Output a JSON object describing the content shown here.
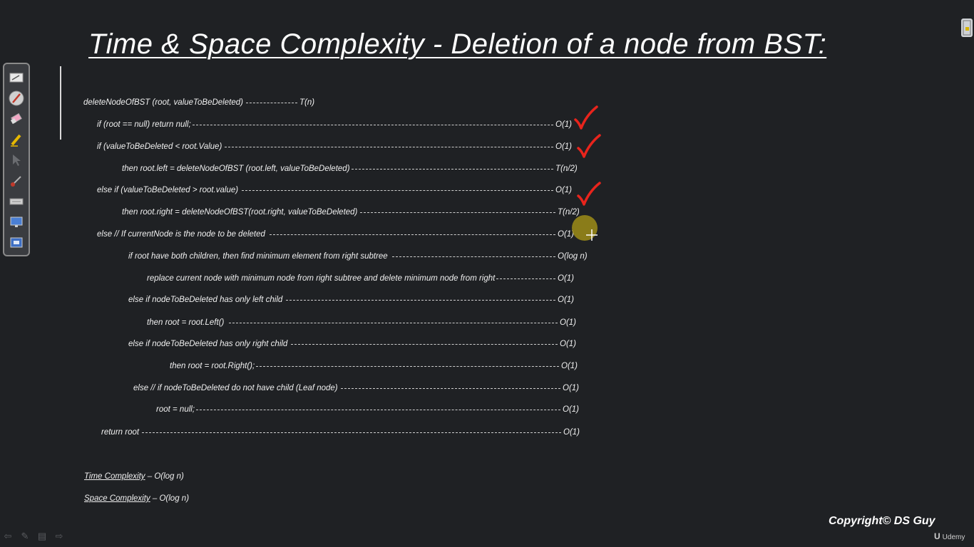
{
  "slide": {
    "title": "Time & Space Complexity - Deletion of a node from BST:",
    "code_lines": [
      {
        "text": "deleteNodeOfBST (root, valueToBeDeleted)",
        "complexity": "T(n)"
      },
      {
        "text": "if (root == null) return null;",
        "complexity": "O(1)",
        "checked": true
      },
      {
        "text": "if (valueToBeDeleted  < root.Value)",
        "complexity": "O(1)",
        "checked": true
      },
      {
        "text": "then root.left = deleteNodeOfBST  (root.left, valueToBeDeleted)",
        "complexity": "T(n/2)"
      },
      {
        "text": "else if (valueToBeDeleted  > root.value)",
        "complexity": "O(1)",
        "checked": true
      },
      {
        "text": "then root.right = deleteNodeOfBST(root.right, valueToBeDeleted)",
        "complexity": "T(n/2)"
      },
      {
        "text": "else  // If currentNode is the node to be deleted",
        "complexity": "O(1)"
      },
      {
        "text": "if root have both children, then find minimum  element  from right subtree",
        "complexity": "O(log n)"
      },
      {
        "text": "replace current node with minimum  node from right subtree and delete minimum  node from right",
        "complexity": "O(1)"
      },
      {
        "text": "else if nodeToBeDeleted  has only left child",
        "complexity": "O(1)"
      },
      {
        "text": "then  root = root.Left()",
        "complexity": "O(1)"
      },
      {
        "text": "else if nodeToBeDeleted  has only right child",
        "complexity": "O(1)"
      },
      {
        "text": "then root = root.Right();",
        "complexity": "O(1)"
      },
      {
        "text": "else // if nodeToBeDeleted  do not have child (Leaf node)",
        "complexity": "O(1)"
      },
      {
        "text": "root = null;",
        "complexity": "O(1)"
      },
      {
        "text": "return root",
        "complexity": "O(1)"
      }
    ],
    "time_complexity": {
      "label": "Time Complexity",
      "value": "– O(log n)"
    },
    "space_complexity": {
      "label": "Space Complexity",
      "value": "– O(log n)"
    },
    "copyright": "Copyright© DS Guy",
    "brand": {
      "logo": "U",
      "name": "Udemy"
    }
  },
  "toolbar": {
    "tools": [
      "slide-view-icon",
      "pen-icon",
      "eraser-icon",
      "highlighter-icon",
      "pointer-icon",
      "brush-icon",
      "keyboard-icon",
      "screen-icon",
      "screen-switch-icon"
    ]
  },
  "bottom_nav": [
    "back-arrow-icon",
    "pen-icon",
    "menu-icon",
    "forward-arrow-icon"
  ],
  "colors": {
    "background": "#1f2124",
    "check": "#e8241c",
    "pointer": "#9e8c18"
  }
}
